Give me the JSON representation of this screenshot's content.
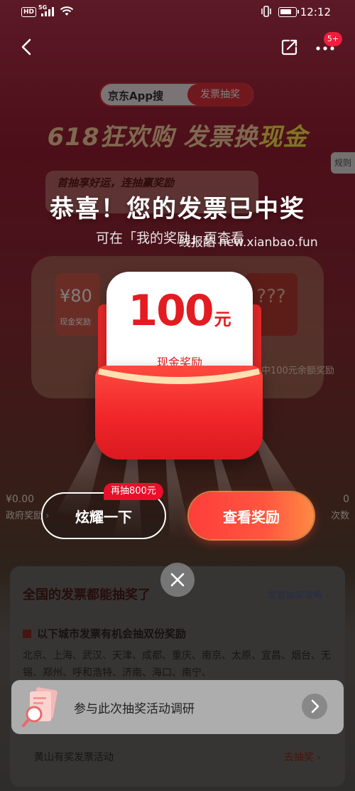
{
  "status_bar": {
    "hd": "HD",
    "network": "5G",
    "time": "12:12"
  },
  "nav": {
    "badge": "5+"
  },
  "background": {
    "search_brand": "京东App搜",
    "search_keyword": "发票抽奖",
    "banner_a": "618狂欢购 发票换",
    "banner_b": "现金",
    "rules": "规则",
    "luck_text": "首抽享好运，连抽赢奖励",
    "card_value": "¥80",
    "card_sub": "现金奖励",
    "card_unknown": "???",
    "card_note": "中100元余额奖励",
    "left_stat_value": "¥0.00",
    "left_stat_label": "政府奖励 ›",
    "right_stat_value": "0",
    "right_stat_label": "次数",
    "panel_title": "全国的发票都能抽奖了",
    "panel_guide": "发票抽奖攻略 ›",
    "city_title": "以下城市发票有机会抽双份奖励",
    "city_list": "北京、上海、武汉、天津、成都、重庆、南京、太原、宜昌、烟台、无锡、郑州、呼和浩特、济南、海口、南宁、",
    "event_name": "黄山有奖发票活动",
    "event_action": "去抽奖 ›"
  },
  "modal": {
    "title": "恭喜！您的发票已中奖",
    "subtitle": "可在「我的奖励」页查看",
    "watermark": "线报酷 new.xianbao.fun",
    "prize_amount": "100",
    "prize_unit": "元",
    "prize_label": "现金奖励",
    "show_off_label": "炫耀一下",
    "show_off_tag": "再抽800元",
    "view_reward_label": "查看奖励"
  },
  "survey": {
    "text": "参与此次抽奖活动调研"
  },
  "colors": {
    "accent_red": "#e31c22",
    "button_gradient_start": "#ff3e3a",
    "button_gradient_end": "#ff8a44",
    "badge_red": "#f21c3c"
  }
}
